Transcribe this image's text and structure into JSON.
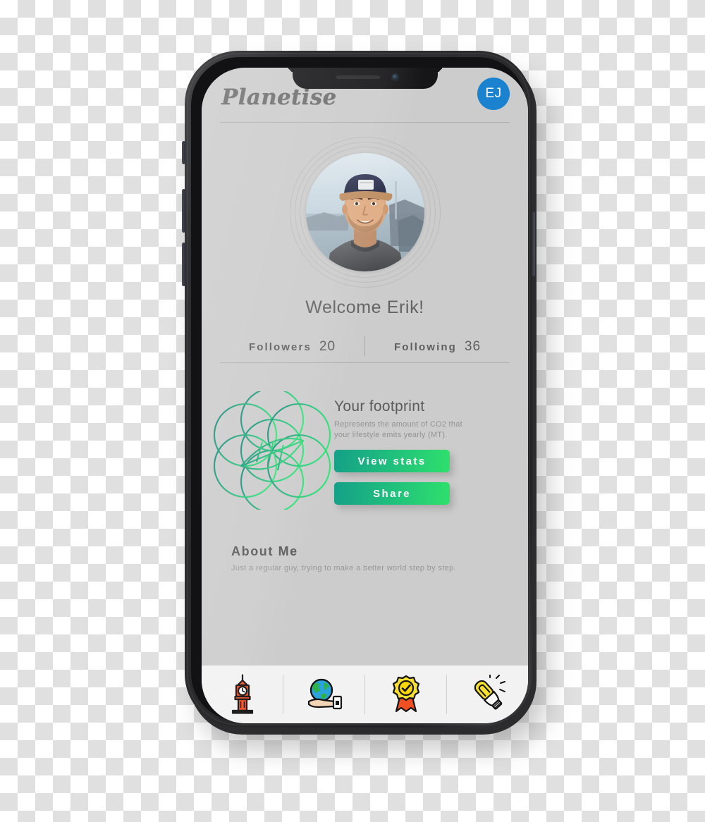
{
  "app": {
    "brand": "Planetise",
    "avatar_initials": "EJ",
    "avatar_color": "#1a82ce"
  },
  "profile": {
    "photo_alt": "profile-photo",
    "welcome": "Welcome Erik!",
    "stats": [
      {
        "label": "Followers",
        "value": "20",
        "name": "followers"
      },
      {
        "label": "Following",
        "value": "36",
        "name": "following"
      }
    ]
  },
  "footprint": {
    "title": "Your footprint",
    "description": "Represents the amount of CO2 that your lifestyle emits yearly (MT).",
    "buttons": [
      {
        "label": "View stats",
        "name": "view-stats"
      },
      {
        "label": "Share",
        "name": "share"
      }
    ],
    "accent_start": "#15a087",
    "accent_end": "#2ee06c"
  },
  "about": {
    "title": "About Me",
    "text": "Just a regular guy, trying to make a better world step by step."
  },
  "bottom_nav": [
    {
      "icon": "clock-tower-icon",
      "name": "nav-item-clock-tower"
    },
    {
      "icon": "globe-in-hand-icon",
      "name": "nav-item-globe"
    },
    {
      "icon": "award-ribbon-icon",
      "name": "nav-item-award"
    },
    {
      "icon": "light-bulb-icon",
      "name": "nav-item-bulb"
    }
  ]
}
